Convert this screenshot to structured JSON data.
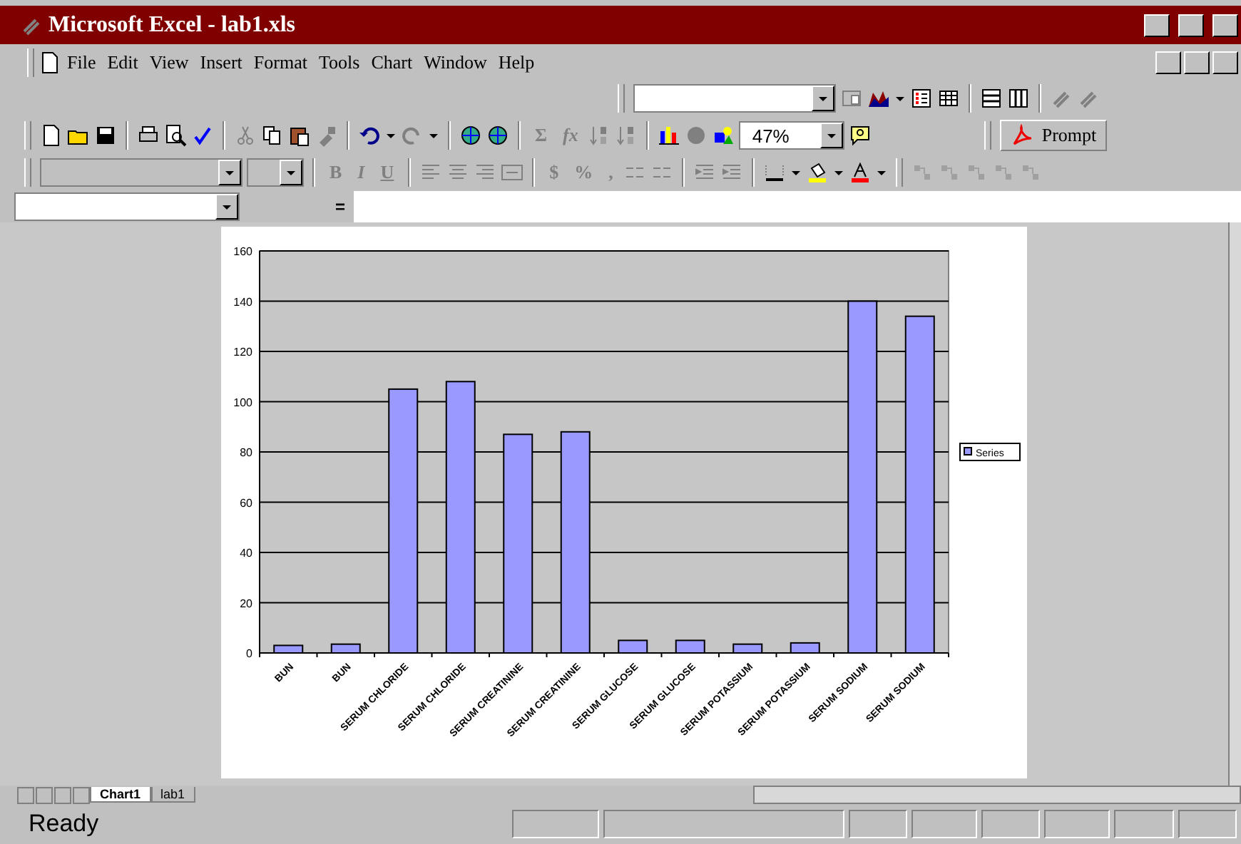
{
  "window": {
    "title": "Microsoft Excel - lab1.xls"
  },
  "menu": [
    "File",
    "Edit",
    "View",
    "Insert",
    "Format",
    "Tools",
    "Chart",
    "Window",
    "Help"
  ],
  "standard_toolbar": {
    "sum": "Σ",
    "function": "fx",
    "zoom": "47%",
    "pdf_label": "Prompt"
  },
  "formatting_toolbar": {
    "styles": [
      "B",
      "I",
      "U"
    ],
    "number_formats": [
      "$",
      "%",
      ","
    ]
  },
  "formula_bar": {
    "equals": "="
  },
  "chart": {
    "chart_data": {
      "type": "bar",
      "categories": [
        "BUN",
        "BUN",
        "SERUM CHLORIDE",
        "SERUM CHLORIDE",
        "SERUM CREATININE",
        "SERUM CREATININE",
        "SERUM GLUCOSE",
        "SERUM GLUCOSE",
        "SERUM POTASSIUM",
        "SERUM POTASSIUM",
        "SERUM SODIUM",
        "SERUM SODIUM"
      ],
      "series": [
        {
          "name": "Series",
          "color": "#9999ff",
          "values": [
            3,
            3.5,
            105,
            108,
            87,
            88,
            5,
            5,
            3.5,
            4,
            140,
            134
          ]
        }
      ],
      "ylim": [
        0,
        160
      ],
      "grid": true,
      "yticks": [
        0,
        20,
        40,
        60,
        80,
        100,
        120,
        140,
        160
      ]
    }
  },
  "sheet_tabs": [
    {
      "label": "Chart1",
      "selected": true
    },
    {
      "label": "lab1",
      "selected": false
    }
  ],
  "status_bar": {
    "text": "Ready"
  }
}
